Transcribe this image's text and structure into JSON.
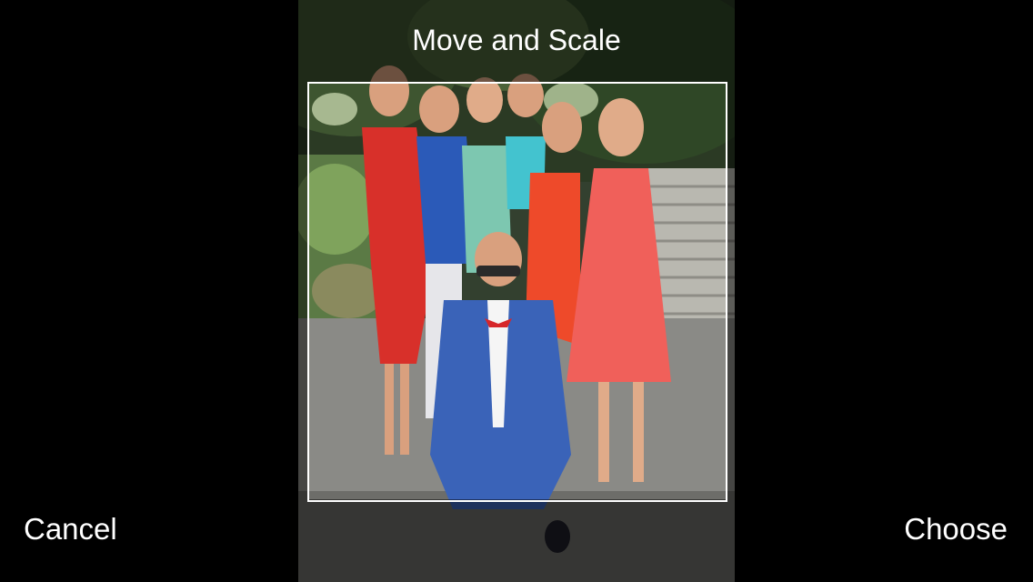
{
  "header": {
    "title": "Move and Scale"
  },
  "actions": {
    "cancel_label": "Cancel",
    "choose_label": "Choose"
  },
  "colors": {
    "background": "#000000",
    "text": "#ffffff",
    "crop_border": "#ffffff"
  }
}
